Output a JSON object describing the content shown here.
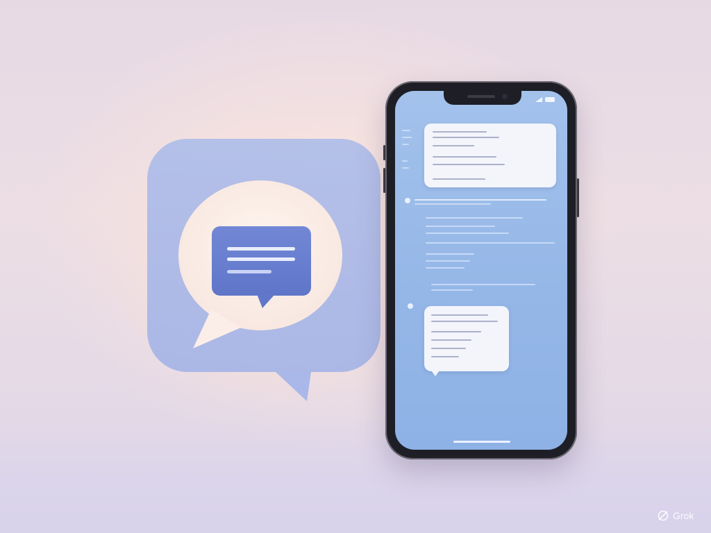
{
  "colors": {
    "icon_tile": "#a9b8e8",
    "icon_bubble_white": "#fbf0ea",
    "icon_inner_bubble": "#6a7fd0",
    "phone_screen": "#9dbdea",
    "phone_frame": "#1e1f26",
    "background": "#e8dbe4"
  },
  "scene": {
    "chat_icon": "chat-bubble-app-icon",
    "device": "smartphone"
  },
  "watermark": {
    "logo_icon": "grok-logo-icon",
    "label": "Grok"
  }
}
